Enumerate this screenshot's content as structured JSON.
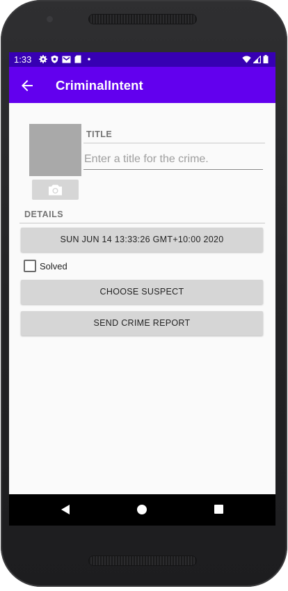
{
  "status_bar": {
    "time": "1:33",
    "icons": [
      "settings-icon",
      "shield-icon",
      "gmail-icon",
      "sd-card-icon",
      "dot-icon",
      "wifi-icon",
      "cell-signal-icon",
      "battery-icon"
    ]
  },
  "app_bar": {
    "title": "CriminalIntent",
    "background": "#6200ee",
    "status_background": "#3700b3"
  },
  "crime": {
    "title_label": "TITLE",
    "title_placeholder": "Enter a title for the crime.",
    "title_value": "",
    "details_label": "DETAILS",
    "date_button": "SUN JUN 14 13:33:26 GMT+10:00 2020",
    "solved_label": "Solved",
    "solved_checked": false,
    "choose_suspect_button": "CHOOSE SUSPECT",
    "send_report_button": "SEND CRIME REPORT"
  },
  "nav_bar": {
    "icons": [
      "nav-back-icon",
      "nav-home-icon",
      "nav-recents-icon"
    ]
  }
}
